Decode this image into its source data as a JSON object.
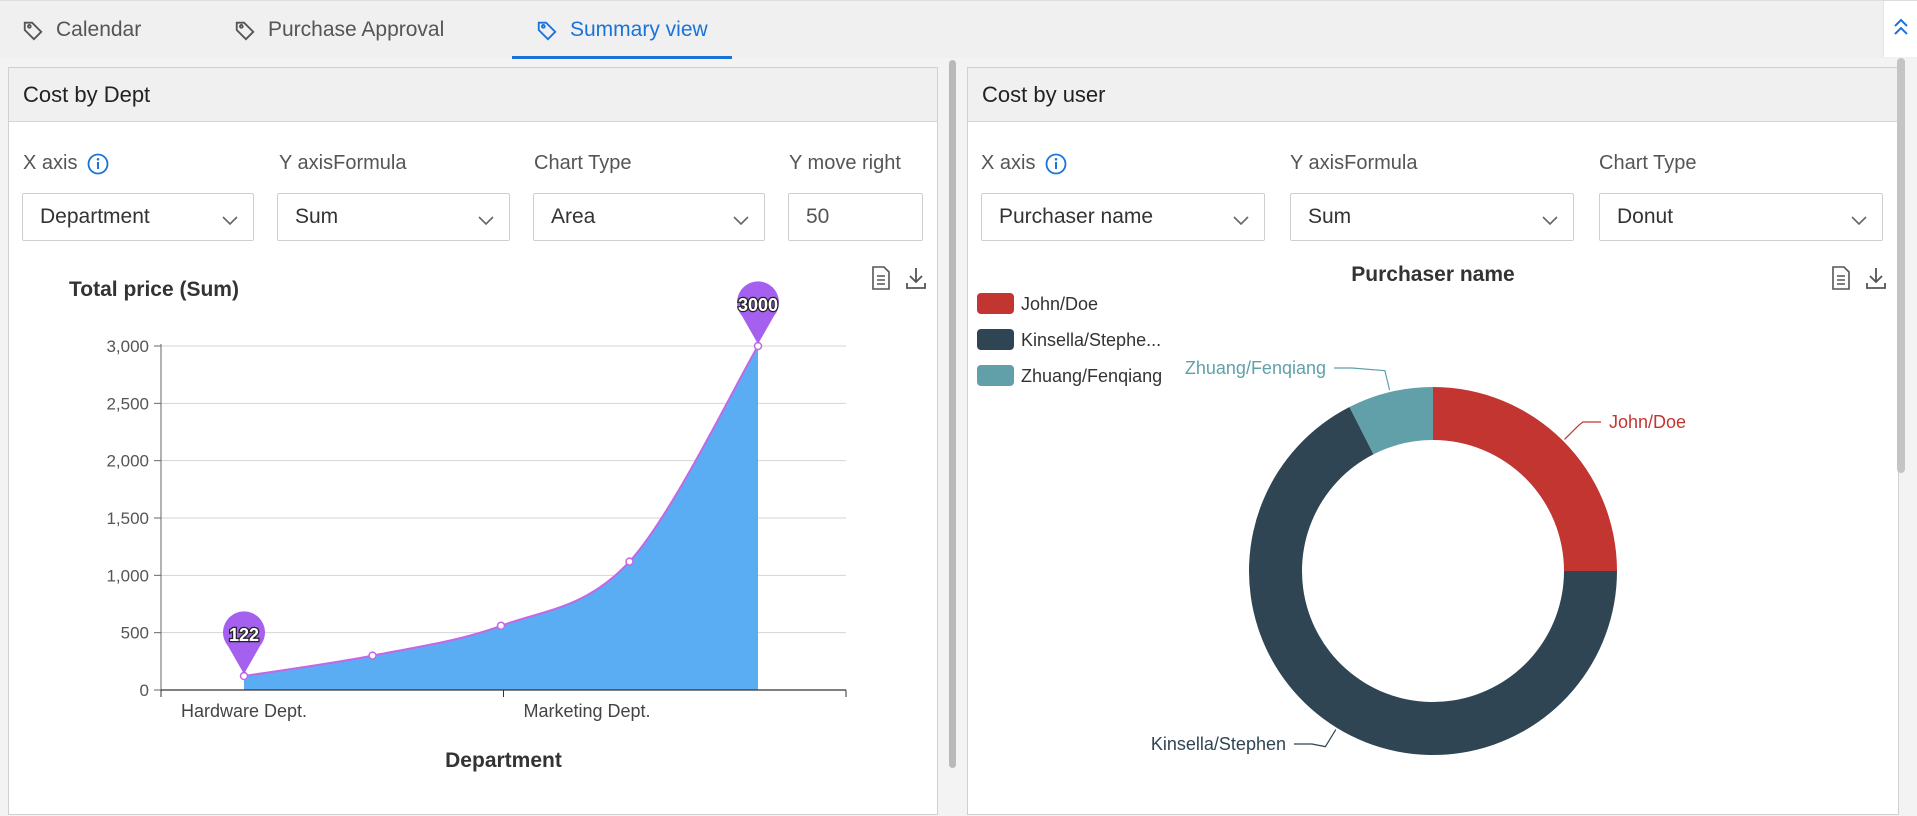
{
  "tabs": [
    {
      "label": "Calendar",
      "active": false
    },
    {
      "label": "Purchase Approval",
      "active": false
    },
    {
      "label": "Summary view",
      "active": true
    }
  ],
  "colors": {
    "accent": "#1a73d9",
    "area_fill": "#5aadf3",
    "area_line": "#c467e6",
    "marker": "#a660ef",
    "john": "#c23531",
    "kinsella": "#2f4554",
    "zhuang": "#61a0a8"
  },
  "left_panel": {
    "title": "Cost by Dept",
    "controls": {
      "x_axis_label": "X axis",
      "x_axis_value": "Department",
      "y_formula_label": "Y axisFormula",
      "y_formula_value": "Sum",
      "chart_type_label": "Chart Type",
      "chart_type_value": "Area",
      "y_move_label": "Y move right",
      "y_move_value": "50"
    },
    "icons": [
      "document-icon",
      "download-icon"
    ]
  },
  "right_panel": {
    "title": "Cost by user",
    "controls": {
      "x_axis_label": "X axis",
      "x_axis_value": "Purchaser name",
      "y_formula_label": "Y axisFormula",
      "y_formula_value": "Sum",
      "chart_type_label": "Chart Type",
      "chart_type_value": "Donut"
    },
    "icons": [
      "document-icon",
      "download-icon"
    ]
  },
  "chart_data": [
    {
      "type": "area",
      "title": "Total price (Sum)",
      "xlabel": "Department",
      "ylabel": "",
      "categories": [
        "Hardware Dept.",
        "Marketing Dept."
      ],
      "x": [
        0,
        1,
        2,
        3,
        4
      ],
      "values": [
        122,
        300,
        560,
        1120,
        3000
      ],
      "ylim": [
        0,
        3000
      ],
      "yticks": [
        "0",
        "500",
        "1,000",
        "1,500",
        "2,000",
        "2,500",
        "3,000"
      ],
      "markers": [
        {
          "label": "122"
        },
        {
          "label": "3000"
        }
      ],
      "grid": true
    },
    {
      "type": "pie",
      "variant": "donut",
      "title": "Purchaser name",
      "legend_position": "top-left",
      "legend": [
        "John/Doe",
        "Kinsella/Stephe...",
        "Zhuang/Fenqiang"
      ],
      "slices": [
        {
          "name": "John/Doe",
          "value": 25
        },
        {
          "name": "Kinsella/Stephen",
          "value": 67.5
        },
        {
          "name": "Zhuang/Fenqiang",
          "value": 7.5
        }
      ]
    }
  ]
}
